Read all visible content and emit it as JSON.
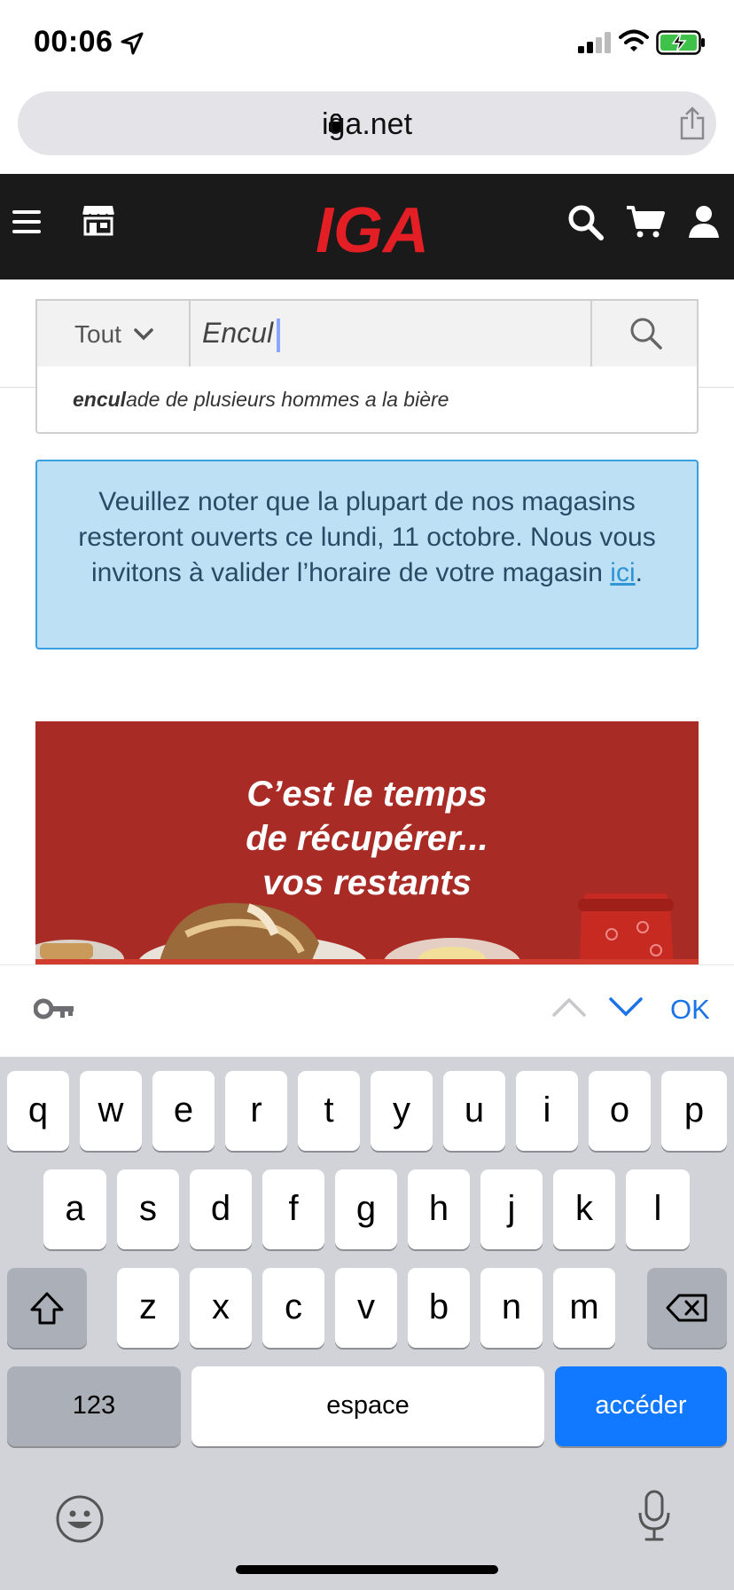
{
  "status_bar": {
    "time": "00:06",
    "location_icon": "location-arrow-icon",
    "signal_icon": "cellular-signal-icon",
    "wifi_icon": "wifi-icon",
    "battery_icon": "battery-charging-icon"
  },
  "browser": {
    "url": "iga.net",
    "lock_icon": "lock-icon",
    "share_icon": "share-icon"
  },
  "header": {
    "logo_text": "IGA",
    "brand_color": "#e31e24",
    "background": "#1a1a1a",
    "icons": [
      "menu-icon",
      "store-icon",
      "search-icon",
      "cart-icon",
      "user-icon"
    ]
  },
  "search": {
    "scope_label": "Tout",
    "query": "Encul",
    "suggestion_match": "encul",
    "suggestion_rest": "ade de plusieurs hommes a la bière"
  },
  "notice": {
    "text": "Veuillez noter que la plupart de nos magasins resteront ouverts ce lundi, 11 octobre. Nous vous invitons à valider l’horaire de votre magasin ",
    "link_text": "ici",
    "end": "."
  },
  "banner": {
    "line1": "C’est le temps",
    "line2": "de récupérer...",
    "line3": "vos restants",
    "background": "#a92b25"
  },
  "accessory_bar": {
    "ok_label": "OK",
    "key_icon": "key-icon",
    "prev_icon": "chevron-up-icon",
    "next_icon": "chevron-down-icon"
  },
  "keyboard": {
    "row1": [
      "q",
      "w",
      "e",
      "r",
      "t",
      "y",
      "u",
      "i",
      "o",
      "p"
    ],
    "row2": [
      "a",
      "s",
      "d",
      "f",
      "g",
      "h",
      "j",
      "k",
      "l"
    ],
    "row3": [
      "z",
      "x",
      "c",
      "v",
      "b",
      "n",
      "m"
    ],
    "numbers_label": "123",
    "space_label": "espace",
    "go_label": "accéder",
    "go_color": "#1179ff"
  }
}
